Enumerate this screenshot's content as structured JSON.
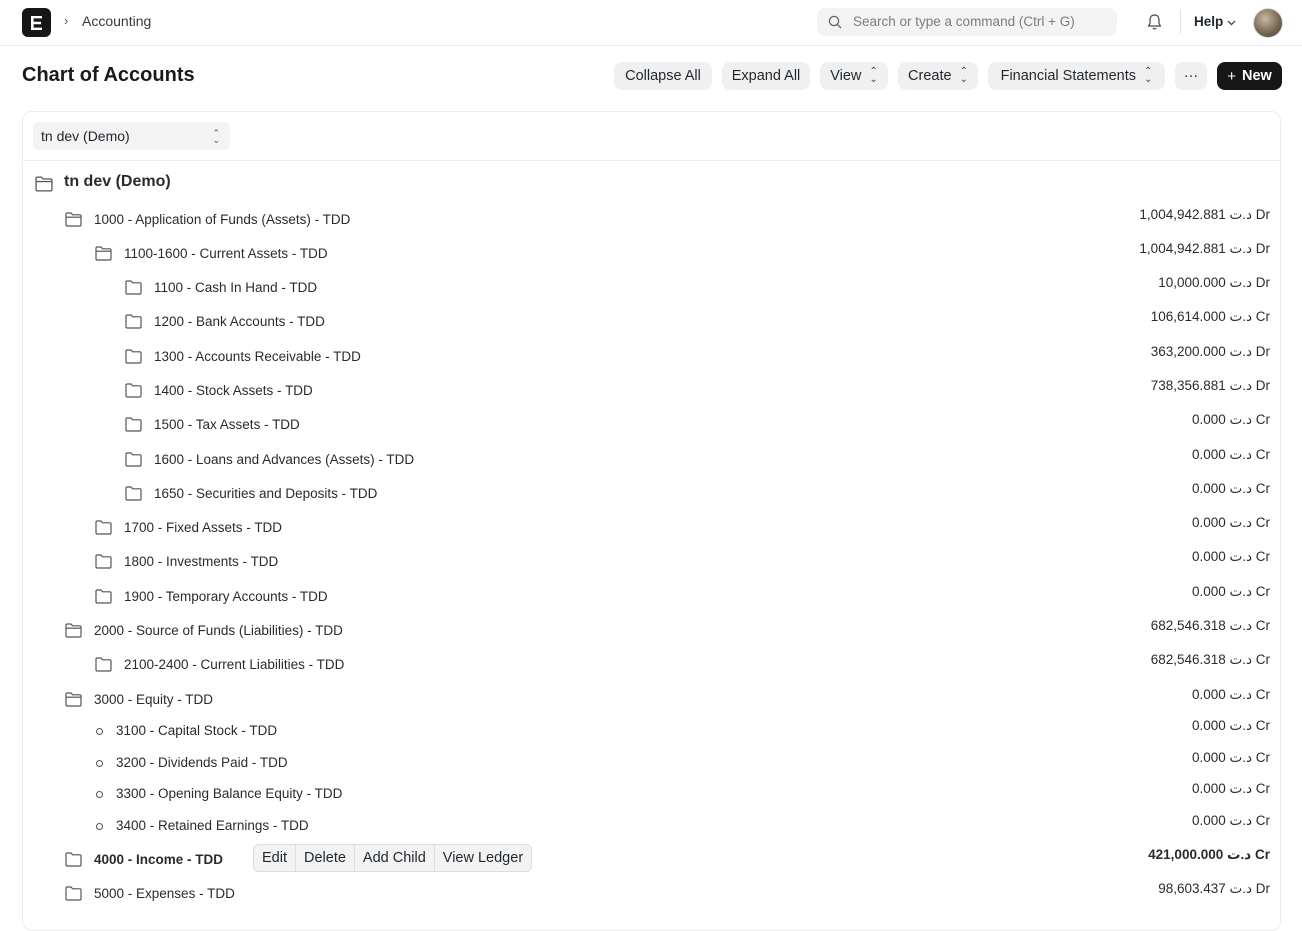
{
  "navbar": {
    "breadcrumb": "Accounting",
    "search_placeholder": "Search or type a command (Ctrl + G)",
    "help_label": "Help"
  },
  "page": {
    "title": "Chart of Accounts",
    "buttons": {
      "collapse_all": "Collapse All",
      "expand_all": "Expand All",
      "view": "View",
      "create": "Create",
      "financial_statements": "Financial Statements",
      "more": "···",
      "new": "New"
    }
  },
  "company_select": {
    "value": "tn dev (Demo)"
  },
  "tree": {
    "root_label": "tn dev (Demo)",
    "nodes": [
      {
        "label": "1000 - Application of Funds (Assets) - TDD",
        "balance": "1,004,942.881 د.ت Dr"
      },
      {
        "label": "1100-1600 - Current Assets - TDD",
        "balance": "1,004,942.881 د.ت Dr"
      },
      {
        "label": "1100 - Cash In Hand - TDD",
        "balance": "10,000.000 د.ت Dr"
      },
      {
        "label": "1200 - Bank Accounts - TDD",
        "balance": "106,614.000 د.ت Cr"
      },
      {
        "label": "1300 - Accounts Receivable - TDD",
        "balance": "363,200.000 د.ت Dr"
      },
      {
        "label": "1400 - Stock Assets - TDD",
        "balance": "738,356.881 د.ت Dr"
      },
      {
        "label": "1500 - Tax Assets - TDD",
        "balance": "0.000 د.ت Cr"
      },
      {
        "label": "1600 - Loans and Advances (Assets) - TDD",
        "balance": "0.000 د.ت Cr"
      },
      {
        "label": "1650 - Securities and Deposits - TDD",
        "balance": "0.000 د.ت Cr"
      },
      {
        "label": "1700 - Fixed Assets - TDD",
        "balance": "0.000 د.ت Cr"
      },
      {
        "label": "1800 - Investments - TDD",
        "balance": "0.000 د.ت Cr"
      },
      {
        "label": "1900 - Temporary Accounts - TDD",
        "balance": "0.000 د.ت Cr"
      },
      {
        "label": "2000 - Source of Funds (Liabilities) - TDD",
        "balance": "682,546.318 د.ت Cr"
      },
      {
        "label": "2100-2400 - Current Liabilities - TDD",
        "balance": "682,546.318 د.ت Cr"
      },
      {
        "label": "3000 - Equity - TDD",
        "balance": "0.000 د.ت Cr"
      },
      {
        "label": "3100 - Capital Stock - TDD",
        "balance": "0.000 د.ت Cr"
      },
      {
        "label": "3200 - Dividends Paid - TDD",
        "balance": "0.000 د.ت Cr"
      },
      {
        "label": "3300 - Opening Balance Equity - TDD",
        "balance": "0.000 د.ت Cr"
      },
      {
        "label": "3400 - Retained Earnings - TDD",
        "balance": "0.000 د.ت Cr"
      },
      {
        "label": "4000 - Income - TDD",
        "balance": "421,000.000 د.ت Cr"
      },
      {
        "label": "5000 - Expenses - TDD",
        "balance": "98,603.437 د.ت Dr"
      }
    ]
  },
  "row_actions": {
    "edit": "Edit",
    "delete": "Delete",
    "add_child": "Add Child",
    "view_ledger": "View Ledger"
  }
}
